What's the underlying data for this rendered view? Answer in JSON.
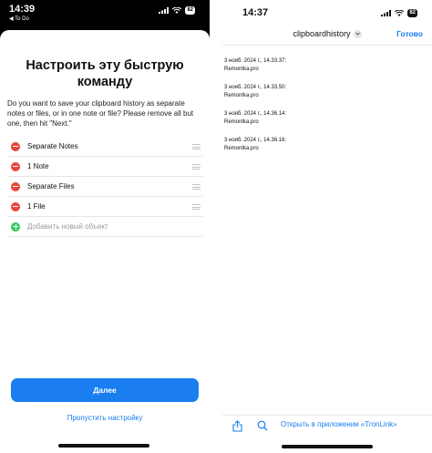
{
  "left": {
    "status": {
      "time": "14:39",
      "back_label": "◀ To Do",
      "battery": "82"
    },
    "sheet": {
      "title": "Настроить эту быструю команду",
      "description": "Do you want to save your clipboard history as separate notes or files, or in one note or file? Please remove all but one, then hit \"Next.\"",
      "options": [
        {
          "label": "Separate Notes"
        },
        {
          "label": "1 Note"
        },
        {
          "label": "Separate Files"
        },
        {
          "label": "1 File"
        }
      ],
      "add_label": "Добавить новый объект",
      "next_label": "Далее",
      "skip_label": "Пропустить настройку"
    },
    "colors": {
      "accent": "#1a7ef0",
      "remove": "#e8443a",
      "add": "#35c759"
    }
  },
  "right": {
    "status": {
      "time": "14:37",
      "battery": "82"
    },
    "header": {
      "title": "clipboardhistory",
      "done_label": "Готово"
    },
    "entries": [
      {
        "line1": "3 нояб. 2024 г., 14.33.37:",
        "line2": "Remontka.pro"
      },
      {
        "line1": "3 нояб. 2024 г., 14.33.50:",
        "line2": "Remontka.pro"
      },
      {
        "line1": "3 нояб. 2024 г., 14.36.14:",
        "line2": "Remontka.pro"
      },
      {
        "line1": "3 нояб. 2024 г., 14.36.16:",
        "line2": "Remontka.pro"
      }
    ],
    "bottom": {
      "open_in_label": "Открыть в приложении «TronLink»"
    }
  }
}
